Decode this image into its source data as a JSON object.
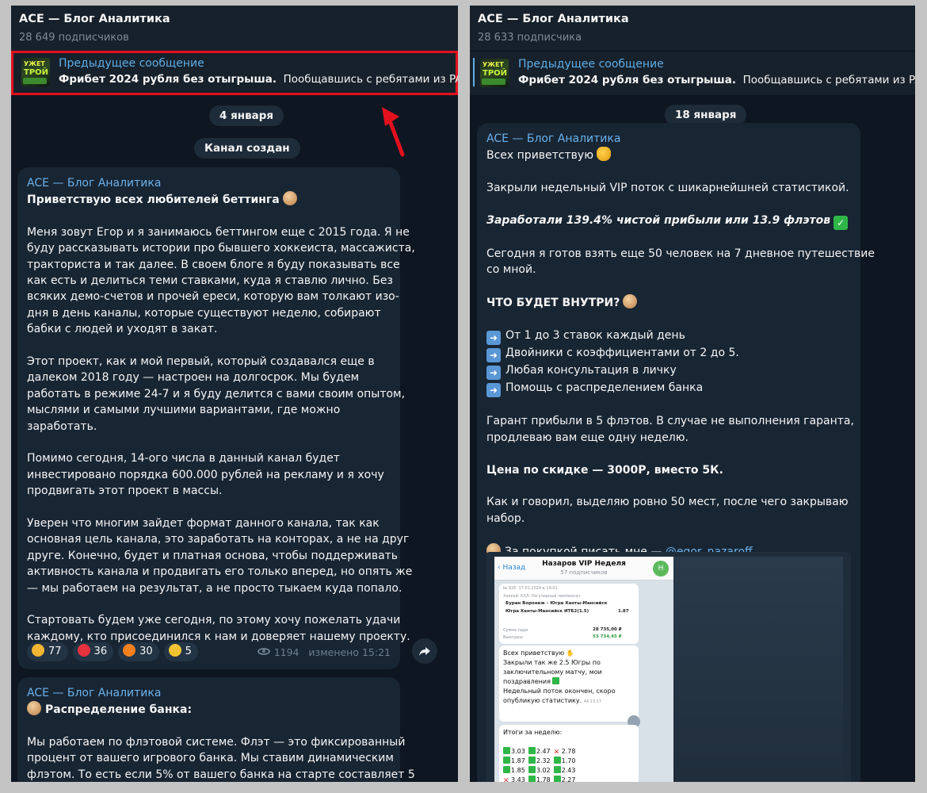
{
  "left_panel": {
    "channel_title": "ACE — Блог Аналитика",
    "subscribers": "28 649 подписчиков",
    "pinned": {
      "thumb_line1": "УЖЕТ",
      "thumb_line2": "ТРОЙ",
      "label": "Предыдущее сообщение",
      "bold_text": "Фрибет 2024 рубля без отыгрыша.",
      "text": "Пообщавшись с ребятами из PARI,"
    },
    "date_pill": "4 января",
    "service_pill": "Канал создан",
    "message1": {
      "author": "ACE — Блог Аналитика",
      "heading": "Приветствую всех любителей беттинга",
      "paragraphs": [
        [
          "Меня зовут Егор и я занимаюсь беттингом еще с 2015 года. Я не",
          "буду рассказывать истории про бывшего хоккеиста, массажиста,",
          "тракториста и так далее. В своем блоге я буду показывать все",
          "как есть и делиться теми ставками, куда я ставлю лично. Без",
          "всяких демо-счетов и прочей ереси, которую вам толкают изо-",
          "дня в день каналы, которые существуют неделю, собирают",
          "бабки с людей и уходят в закат."
        ],
        [
          "Этот проект, как и мой первый, который создавался еще в",
          "далеком 2018 году — настроен на долгосрок. Мы будем",
          "работать в режиме 24-7 и я буду делится с вами своим опытом,",
          "мыслями и самыми лучшими вариантами, где можно",
          "заработать."
        ],
        [
          "Помимо сегодня, 14-ого числа в данный канал будет",
          "инвестировано порядка 600.000 рублей на рекламу и я хочу",
          "продвигать этот проект в массы."
        ],
        [
          "Уверен что многим зайдет формат данного канала, так как",
          "основная цель канала, это заработать на конторах, а не на друг",
          "друге. Конечно, будет и платная основа, чтобы поддерживать",
          "активность канала и продвигать его только вперед, но опять же",
          "— мы работаем на результат, а не просто тыкаем куда попало."
        ],
        [
          "Стартовать будем уже сегодня, по этому хочу пожелать удачи",
          "каждому, кто присоединился к нам и доверяет нашему проекту."
        ]
      ],
      "reactions": [
        {
          "emoji": "thumbs-up",
          "count": "77",
          "color": "#f1b532"
        },
        {
          "emoji": "heart",
          "count": "36",
          "color": "#e5323e"
        },
        {
          "emoji": "fire",
          "count": "30",
          "color": "#f2801e"
        },
        {
          "emoji": "clapping-hands",
          "count": "5",
          "color": "#f1c232"
        }
      ],
      "views": "1194",
      "edited": "изменено 15:21"
    },
    "message2": {
      "author": "ACE — Блог Аналитика",
      "heading": "Распределение банка:",
      "lines": [
        "Мы работаем по флэтовой системе. Флэт — это фиксированный",
        "процент от вашего игрового банка. Мы ставим динамическим",
        "флэтом. То есть если 5% от вашего банка на старте составляет 5"
      ]
    }
  },
  "right_panel": {
    "channel_title": "ACE — Блог Аналитика",
    "subscribers": "28 633 подписчика",
    "pinned": {
      "thumb_line1": "УЖЕТ",
      "thumb_line2": "ТРОЙ",
      "label": "Предыдущее сообщение",
      "bold_text": "Фрибет 2024 рубля без отыгрыша.",
      "text": "Пообщавшись с ребятами из PARI"
    },
    "date_pill": "18 января",
    "message": {
      "author": "ACE — Блог Аналитика",
      "greeting": "Всех приветствую",
      "line_closed": "Закрыли недельный VIP поток с шикарнейшней статистикой.",
      "profit": "Заработали 139.4% чистой прибыли или 13.9 флэтов",
      "line_ready1": "Сегодня я готов взять еще 50 человек на 7 дневное путешествие",
      "line_ready2": "со мной.",
      "inside_heading": "ЧТО БУДЕТ ВНУТРИ?",
      "bullets": [
        "От 1 до 3 ставок каждый день",
        "Двойники с коэффициентами от 2 до 5.",
        "Любая консультация в личку",
        "Помощь с распределением банка"
      ],
      "guarantee1": "Гарант прибыли в 5 флэтов. В случае не выполнения гаранта,",
      "guarantee2": "продлеваю вам еще одну неделю.",
      "price": "Цена по скидке — 3000Р, вместо 5К.",
      "seats1": "Как и говорил, выделяю ровно 50 мест, после чего закрываю",
      "seats2": "набор.",
      "contact_prefix": "За покупкой писать мне —",
      "contact_handle": "@egor_nazaroff"
    },
    "preview": {
      "back": "Назад",
      "title": "Назаров VIP Неделя",
      "subtitle": "57 подписчиков",
      "avatar": "Н",
      "bet_id": "№ 926",
      "bet_date": "17.01.2024 в 19:01",
      "bet_kind": "Хоккей, КХЛ. Регулярный чемпионат",
      "match1": "Буран Воронеж – Югра Ханты-Мансийск",
      "match2": "Югра Ханты-Мансийск ИТБ2(1.5)",
      "coef": "1.87",
      "stake_label": "Сумма пари",
      "stake_value": "28 735,00 ₽",
      "win_label": "Выигрыш",
      "win_value": "53 734,45 ₽",
      "msg_lines": [
        "Всех приветствую",
        "",
        "Закрыли так же 2.5 Югры по",
        "заключительному матчу, мои",
        "поздравления",
        "",
        "Недельный поток окончен, скоро",
        "опубликую статистику."
      ],
      "msg_time": "44 13:17",
      "results_title": "Итоги за неделю:",
      "results": [
        [
          "3.03",
          "2.47",
          "2.78"
        ],
        [
          "1.87",
          "2.32",
          "1.70"
        ],
        [
          "1.85",
          "3.02",
          "2.43"
        ],
        [
          "3.43",
          "1.78",
          "2.27"
        ]
      ],
      "results_marks": [
        [
          "ok",
          "ok",
          "x"
        ],
        [
          "ok",
          "ok",
          "ok"
        ],
        [
          "ok",
          "ok",
          "ok"
        ],
        [
          "x",
          "ok",
          "ok"
        ]
      ]
    }
  },
  "colors": {
    "annotation_red": "#e3101e",
    "accent_link": "#6bb2ec",
    "chat_bg": "#0e1621",
    "bubble_bg": "#182533"
  }
}
